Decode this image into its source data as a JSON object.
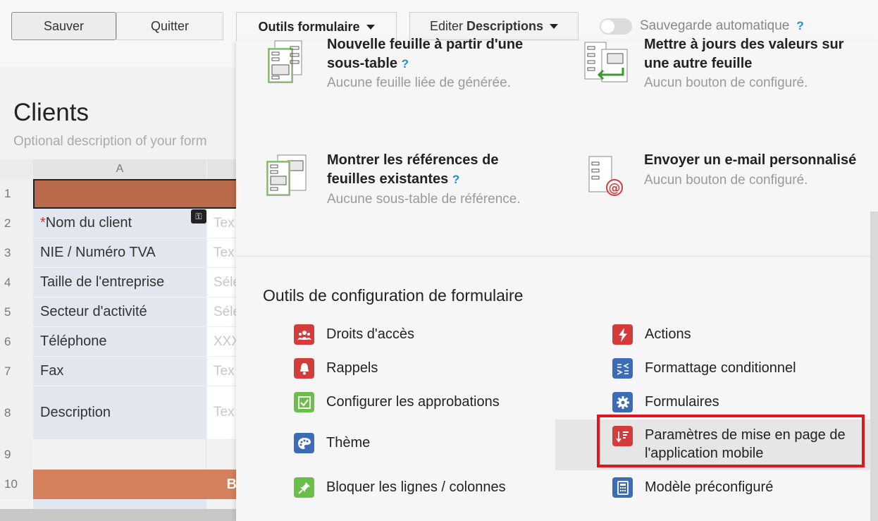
{
  "toolbar": {
    "save_label": "Sauver",
    "quit_label": "Quitter",
    "tools_label": "Outils formulaire",
    "edit_prefix": "Editer",
    "edit_bold": "Descriptions",
    "autosave_label": "Sauvegarde automatique",
    "help": "?"
  },
  "form": {
    "title": "Clients",
    "description": "Optional description of your form",
    "column_a": "A",
    "rows": [
      {
        "num": "1",
        "label": "",
        "value": ""
      },
      {
        "num": "2",
        "label": "Nom du client",
        "required": "*",
        "value": "Tex"
      },
      {
        "num": "3",
        "label": "NIE / Numéro TVA",
        "value": "Tex"
      },
      {
        "num": "4",
        "label": "Taille de l'entreprise",
        "value": "Séle"
      },
      {
        "num": "5",
        "label": "Secteur d'activité",
        "value": "Séle"
      },
      {
        "num": "6",
        "label": "Téléphone",
        "value": "XXX"
      },
      {
        "num": "7",
        "label": "Fax",
        "value": "Tex"
      },
      {
        "num": "8",
        "label": "Description",
        "value": "Tex"
      },
      {
        "num": "9",
        "label": "",
        "value": ""
      },
      {
        "num": "10",
        "label": "",
        "value": "B"
      }
    ]
  },
  "features": {
    "new_sheet": {
      "title_1": "Nouvelle feuille à partir d'une",
      "title_2": "sous-table",
      "help": "?",
      "sub": "Aucune feuille liée de générée."
    },
    "update_values": {
      "title_1": "Mettre à jours des valeurs sur",
      "title_2": "une autre feuille",
      "sub": "Aucun bouton de configuré."
    },
    "show_refs": {
      "title_1": "Montrer les références de",
      "title_2": "feuilles existantes",
      "help": "?",
      "sub": "Aucune sous-table de référence."
    },
    "send_email": {
      "title_1": "Envoyer un e-mail personnalisé",
      "sub": "Aucun bouton de configuré."
    }
  },
  "config": {
    "section_title": "Outils de configuration de formulaire",
    "left": [
      {
        "label": "Droits d'accès",
        "icon": "users-icon"
      },
      {
        "label": "Rappels",
        "icon": "bell-icon"
      },
      {
        "label": "Configurer les approbations",
        "icon": "check-icon"
      },
      {
        "label": "Thème",
        "icon": "palette-icon"
      },
      {
        "label": "Bloquer les lignes / colonnes",
        "icon": "pin-icon"
      }
    ],
    "right": [
      {
        "label": "Actions",
        "icon": "bolt-icon"
      },
      {
        "label": "Formattage conditionnel",
        "icon": "conditional-format-icon"
      },
      {
        "label": "Formulaires",
        "icon": "gear-icon"
      },
      {
        "label_1": "Paramètres de mise en page de",
        "label_2": "l'application mobile",
        "icon": "mobile-layout-icon"
      },
      {
        "label": "Modèle préconfiguré",
        "icon": "template-icon"
      }
    ]
  },
  "colors": {
    "accent_red": "#d43b3b",
    "accent_green": "#6abf4b",
    "accent_blue": "#3b6cb5",
    "highlight": "#e0161e",
    "header_brown": "#b96a4b",
    "section_orange": "#d4805c"
  }
}
